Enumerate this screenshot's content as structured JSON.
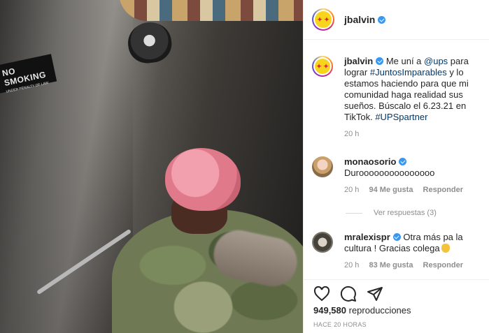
{
  "media": {
    "sign_line1": "NO SMOKING",
    "sign_line2": "UNDER PENALTY OF LAW"
  },
  "header": {
    "username": "jbalvin",
    "avatar_icon": "smiley-avatar-icon"
  },
  "caption": {
    "username": "jbalvin",
    "part1": "Me uní a ",
    "mention": "@ups",
    "part2": " para lograr ",
    "hashtag1": "#JuntosImparables",
    "part3": " y lo estamos haciendo para que mi comunidad haga realidad sus sueños. Búscalo el 6.23.21 en TikTok. ",
    "hashtag2": "#UPSpartner",
    "time": "20 h"
  },
  "comments": [
    {
      "username": "monaosorio",
      "text": "Durooooooooooooooo",
      "time": "20 h",
      "likes": "94 Me gusta",
      "reply": "Responder"
    },
    {
      "username": "mralexispr",
      "text": "Otra más pa la cultura ! Gracias colega",
      "time": "20 h",
      "likes": "83 Me gusta",
      "reply": "Responder"
    }
  ],
  "view_replies": "Ver respuestas (3)",
  "footer": {
    "views_count": "949,580",
    "views_label": "reproducciones",
    "timestamp": "HACE 20 HORAS"
  },
  "colors": {
    "link": "#00376b",
    "verified": "#3897f0",
    "muted": "#8e8e8e"
  }
}
